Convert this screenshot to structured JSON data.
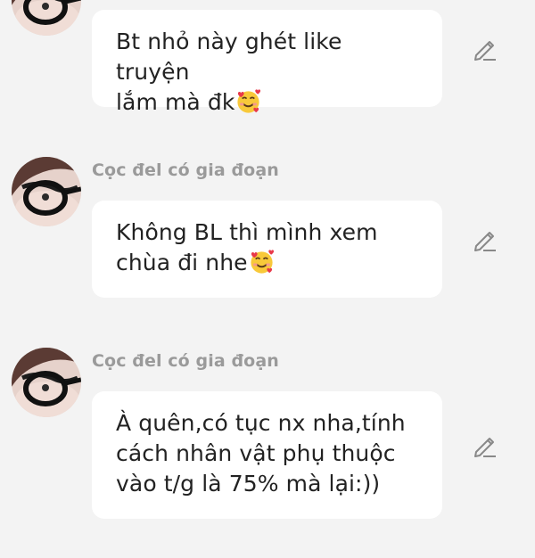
{
  "messages": [
    {
      "author": "",
      "text": "Bt nhỏ này ghét like truyện\nlắm mà đk",
      "emoji": "smiling-face-with-hearts"
    },
    {
      "author": "Cọc đel có gia đoạn",
      "text": "Không BL thì mình xem\nchùa đi nhe",
      "emoji": "smiling-face-with-hearts"
    },
    {
      "author": "Cọc đel có gia đoạn",
      "text": "À quên,có tục nx nha,tính\ncách nhân vật phụ thuộc\nvào t/g là 75% mà lại:))",
      "emoji": ""
    }
  ],
  "icons": {
    "avatar": "avatar-glasses",
    "edit": "pencil-edit-icon",
    "emoji": "smiling-face-with-hearts"
  },
  "colors": {
    "background": "#f3f3f3",
    "bubble": "#ffffff",
    "author": "#9a9a9a",
    "text": "#222222",
    "icon": "#888888"
  }
}
